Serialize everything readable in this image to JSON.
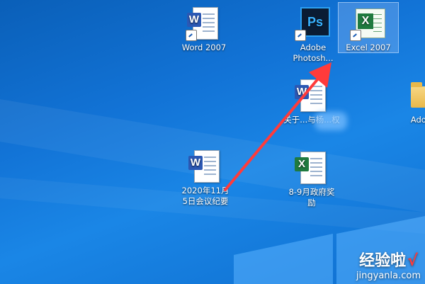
{
  "desktop": {
    "icons": [
      {
        "label": "Word 2007"
      },
      {
        "label": "Adobe Photosh..."
      },
      {
        "label": "Excel 2007"
      },
      {
        "label": "关于...与杨...权"
      },
      {
        "label": "Adobe"
      },
      {
        "label": "2020年11月5日会议纪要"
      },
      {
        "label": "8-9月政府奖励"
      }
    ]
  },
  "watermark": {
    "brand": "经验啦",
    "check": "√",
    "site": "jingyanla.com"
  },
  "colors": {
    "arrow": "#ff3b3b",
    "selection": "#b4d2ff"
  }
}
